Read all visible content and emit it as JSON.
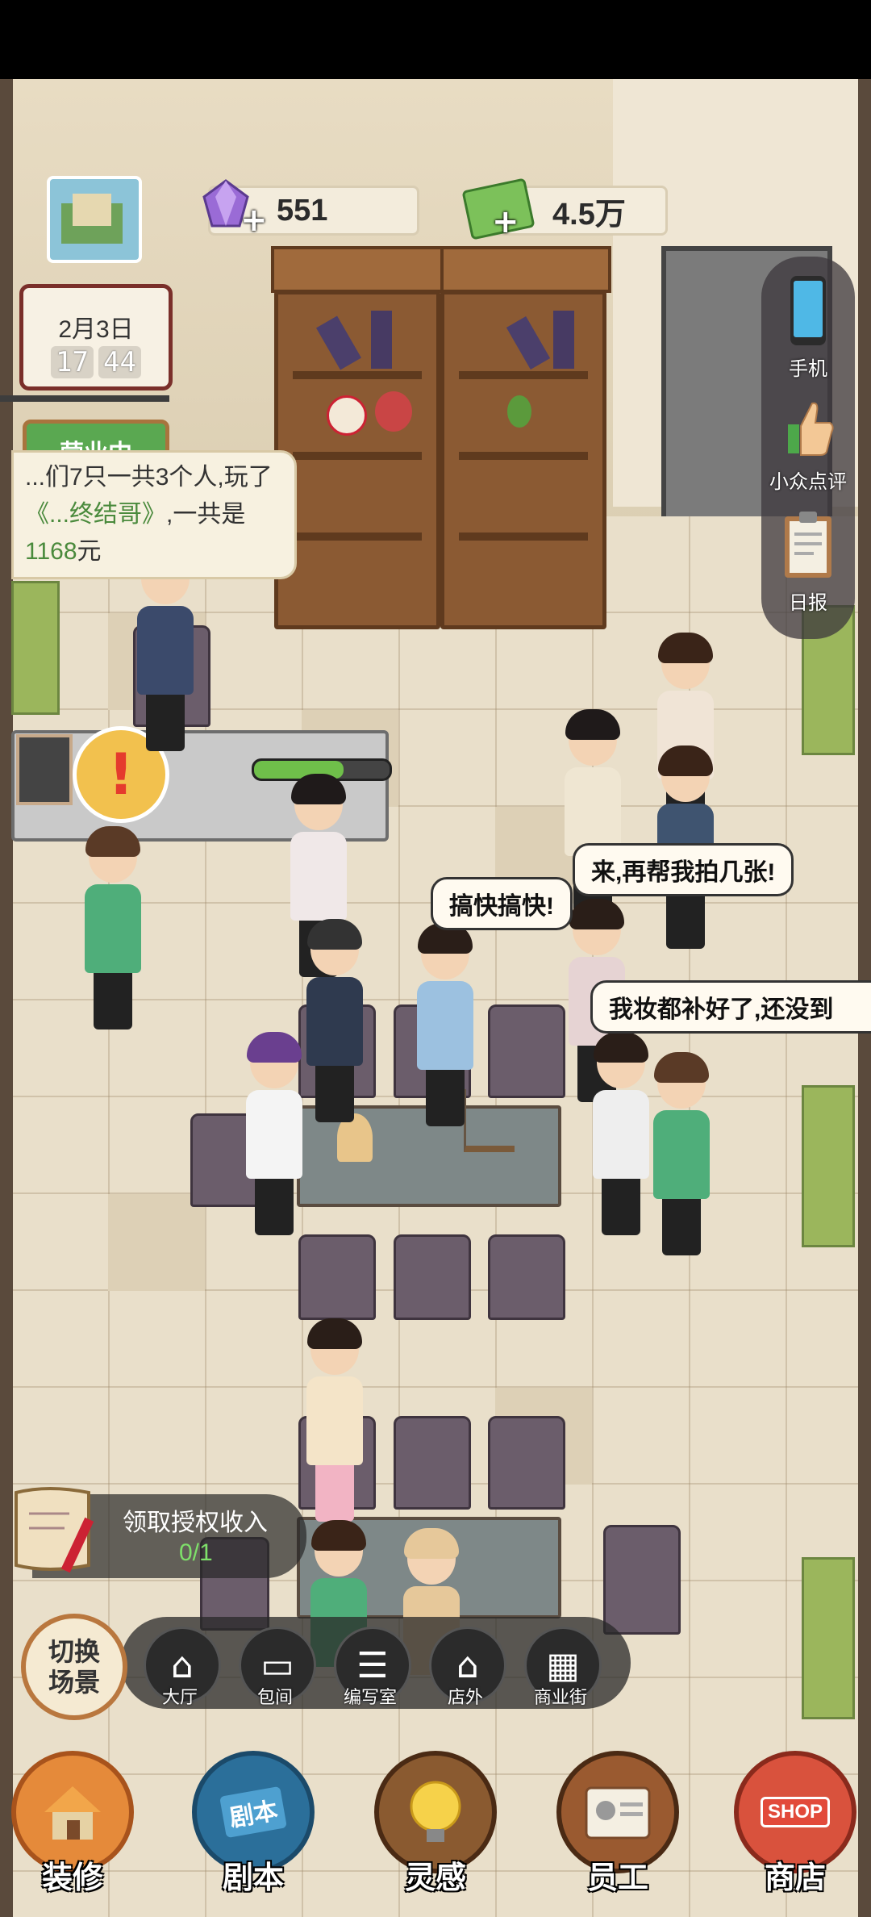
{
  "hud": {
    "gems": "551",
    "cash": "4.5万",
    "calendar_date": "2月3日",
    "clock_hour": "17",
    "clock_minute": "44",
    "status_sign": "营业中"
  },
  "notice": {
    "line1": "...们7只一共3个人,玩了",
    "line2_title": "《...终结哥》",
    "line2_middle": ",一共是",
    "line2_amount": "1168",
    "line2_unit": "元"
  },
  "bubbles": {
    "hurry": "搞快搞快!",
    "photos": "来,再帮我拍几张!",
    "makeup": "我妆都补好了,还没到"
  },
  "side_menu": [
    {
      "label": "手机",
      "icon": "phone-icon"
    },
    {
      "label": "小众点评",
      "icon": "thumbs-up-icon"
    },
    {
      "label": "日报",
      "icon": "clipboard-icon"
    }
  ],
  "license": {
    "label": "领取授权收入",
    "progress": "0/1"
  },
  "scene": {
    "switch_label_1": "切换",
    "switch_label_2": "场景",
    "tabs": [
      {
        "label": "大厅",
        "icon": "house-icon"
      },
      {
        "label": "包间",
        "icon": "sofa-icon"
      },
      {
        "label": "编写室",
        "icon": "desk-icon"
      },
      {
        "label": "店外",
        "icon": "house-icon"
      },
      {
        "label": "商业街",
        "icon": "storefront-icon"
      }
    ]
  },
  "bottom_nav": [
    {
      "label": "装修",
      "icon": "renovate-house-icon"
    },
    {
      "label": "剧本",
      "icon": "script-book-icon",
      "badge": "剧本"
    },
    {
      "label": "灵感",
      "icon": "lightbulb-icon"
    },
    {
      "label": "员工",
      "icon": "staff-badge-icon"
    },
    {
      "label": "商店",
      "icon": "shop-icon",
      "badge": "SHOP"
    }
  ],
  "colors": {
    "accent_green": "#5aa851",
    "wood": "#8b5a33",
    "amount_green": "#4a8a3c"
  }
}
